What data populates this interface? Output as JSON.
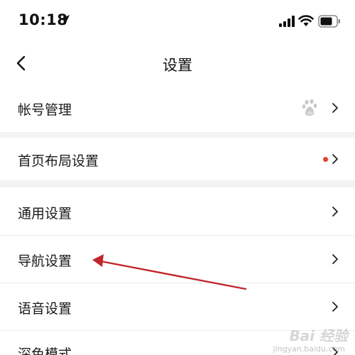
{
  "status_bar": {
    "time": "10:18"
  },
  "nav": {
    "title": "设置"
  },
  "rows": [
    {
      "label": "帐号管理"
    },
    {
      "label": "首页布局设置"
    },
    {
      "label": "通用设置"
    },
    {
      "label": "导航设置"
    },
    {
      "label": "语音设置"
    },
    {
      "label": "深色模式"
    }
  ],
  "watermark": {
    "brand": "Bai 经验",
    "sub": "jingyan.baidu.com"
  },
  "colors": {
    "red_dot": "#e0442f",
    "arrow": "#c0262a",
    "section_gap": "#f3f3f3"
  }
}
